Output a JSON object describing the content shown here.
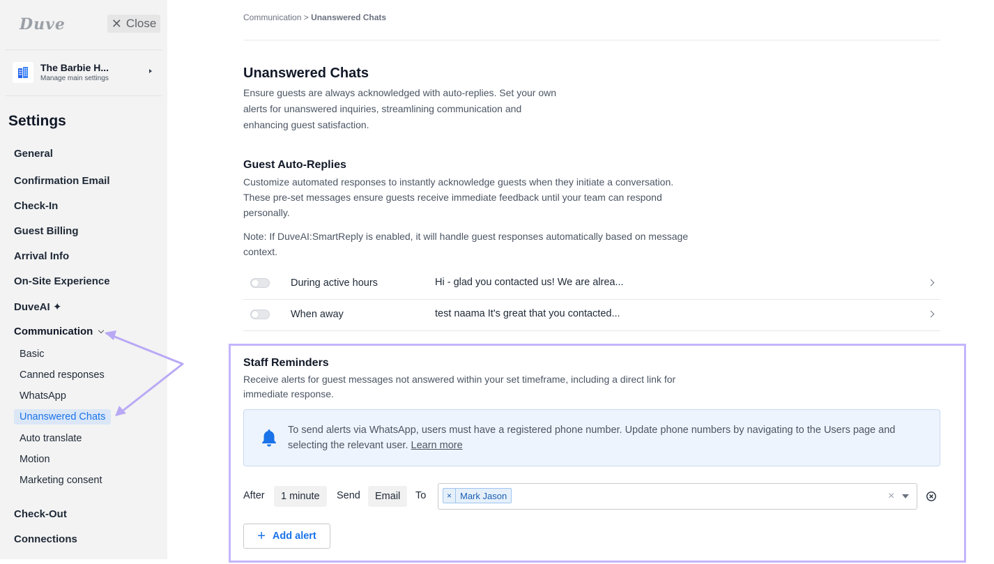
{
  "sidebar": {
    "logo": "Duve",
    "close_label": "Close",
    "property": {
      "name": "The Barbie H...",
      "subtitle": "Manage main settings"
    },
    "settings_title": "Settings",
    "items": [
      {
        "label": "General"
      },
      {
        "label": "Confirmation Email"
      },
      {
        "label": "Check-In"
      },
      {
        "label": "Guest Billing"
      },
      {
        "label": "Arrival Info"
      },
      {
        "label": "On-Site Experience"
      },
      {
        "label": "DuveAI ✦"
      },
      {
        "label": "Communication"
      },
      {
        "label": "Check-Out"
      },
      {
        "label": "Connections"
      }
    ],
    "communication_subitems": [
      {
        "label": "Basic"
      },
      {
        "label": "Canned responses"
      },
      {
        "label": "WhatsApp"
      },
      {
        "label": "Unanswered Chats"
      },
      {
        "label": "Auto translate"
      },
      {
        "label": "Motion"
      },
      {
        "label": "Marketing consent"
      }
    ]
  },
  "main": {
    "breadcrumb": {
      "parent": "Communication",
      "separator": " > ",
      "current": "Unanswered Chats"
    },
    "title": "Unanswered Chats",
    "description": [
      "Ensure guests are always acknowledged with auto-replies. Set your own",
      "alerts for unanswered inquiries, streamlining communication and",
      "enhancing guest satisfaction."
    ],
    "auto_replies": {
      "title": "Guest Auto-Replies",
      "description": [
        "Customize automated responses to instantly acknowledge guests when they initiate a conversation.",
        "These pre-set messages ensure guests receive immediate feedback until your team can respond",
        "personally."
      ],
      "note": [
        "Note: If DuveAI:SmartReply is enabled, it will handle guest responses automatically based on message",
        "context."
      ],
      "rows": [
        {
          "label": "During active hours",
          "message": "Hi - glad you contacted us! We are alrea...",
          "enabled": false
        },
        {
          "label": "When away",
          "message": "test naama It's great that you contacted...",
          "enabled": false
        }
      ]
    },
    "staff_reminders": {
      "title": "Staff Reminders",
      "description": [
        "Receive alerts for guest messages not answered within your set timeframe, including a direct link for",
        "immediate response."
      ],
      "info": {
        "line1": "To send alerts via WhatsApp, users must have a registered phone number. Update phone numbers by navigating to the Users page and",
        "line2": "selecting the relevant user.",
        "link": "Learn more"
      },
      "rule": {
        "after_label": "After",
        "time_value": "1 minute",
        "send_label": "Send",
        "channel_value": "Email",
        "to_label": "To",
        "recipients": [
          "Mark Jason"
        ]
      },
      "add_alert_label": "Add alert"
    }
  },
  "colors": {
    "accent": "#1a73e8",
    "highlight": "#c4b5fd",
    "sidebar_bg": "#f3f3f3",
    "info_bg": "#eef4fd"
  }
}
